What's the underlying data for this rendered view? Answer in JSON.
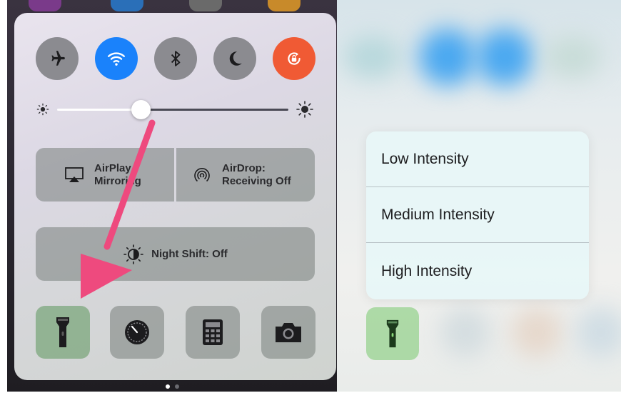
{
  "control_center": {
    "toggles": [
      {
        "name": "airplane-mode",
        "icon": "airplane-icon",
        "active": false,
        "color": "#8b8b90"
      },
      {
        "name": "wifi",
        "icon": "wifi-icon",
        "active": true,
        "color": "#1a82fb"
      },
      {
        "name": "bluetooth",
        "icon": "bluetooth-icon",
        "active": false,
        "color": "#8b8b90"
      },
      {
        "name": "do-not-disturb",
        "icon": "moon-icon",
        "active": false,
        "color": "#8b8b90"
      },
      {
        "name": "orientation-lock",
        "icon": "rotation-lock-icon",
        "active": true,
        "color": "#f05a34"
      }
    ],
    "brightness_level": 0.36,
    "airplay": {
      "line1": "AirPlay",
      "line2": "Mirroring"
    },
    "airdrop": {
      "line1": "AirDrop:",
      "line2": "Receiving Off"
    },
    "night_shift_label": "Night Shift: Off",
    "shortcuts": [
      {
        "name": "flashlight",
        "icon": "flashlight-icon",
        "active": true
      },
      {
        "name": "timer",
        "icon": "timer-icon",
        "active": false
      },
      {
        "name": "calculator",
        "icon": "calculator-icon",
        "active": false
      },
      {
        "name": "camera",
        "icon": "camera-icon",
        "active": false
      }
    ],
    "pages": {
      "count": 2,
      "current": 1
    }
  },
  "flashlight_menu": {
    "items": [
      "Low Intensity",
      "Medium Intensity",
      "High Intensity"
    ]
  },
  "colors": {
    "wifi_blue": "#1a82fb",
    "rotation_orange": "#f05a34",
    "arrow_pink": "#ee4a7e",
    "flash_green": "#7ec86e"
  }
}
